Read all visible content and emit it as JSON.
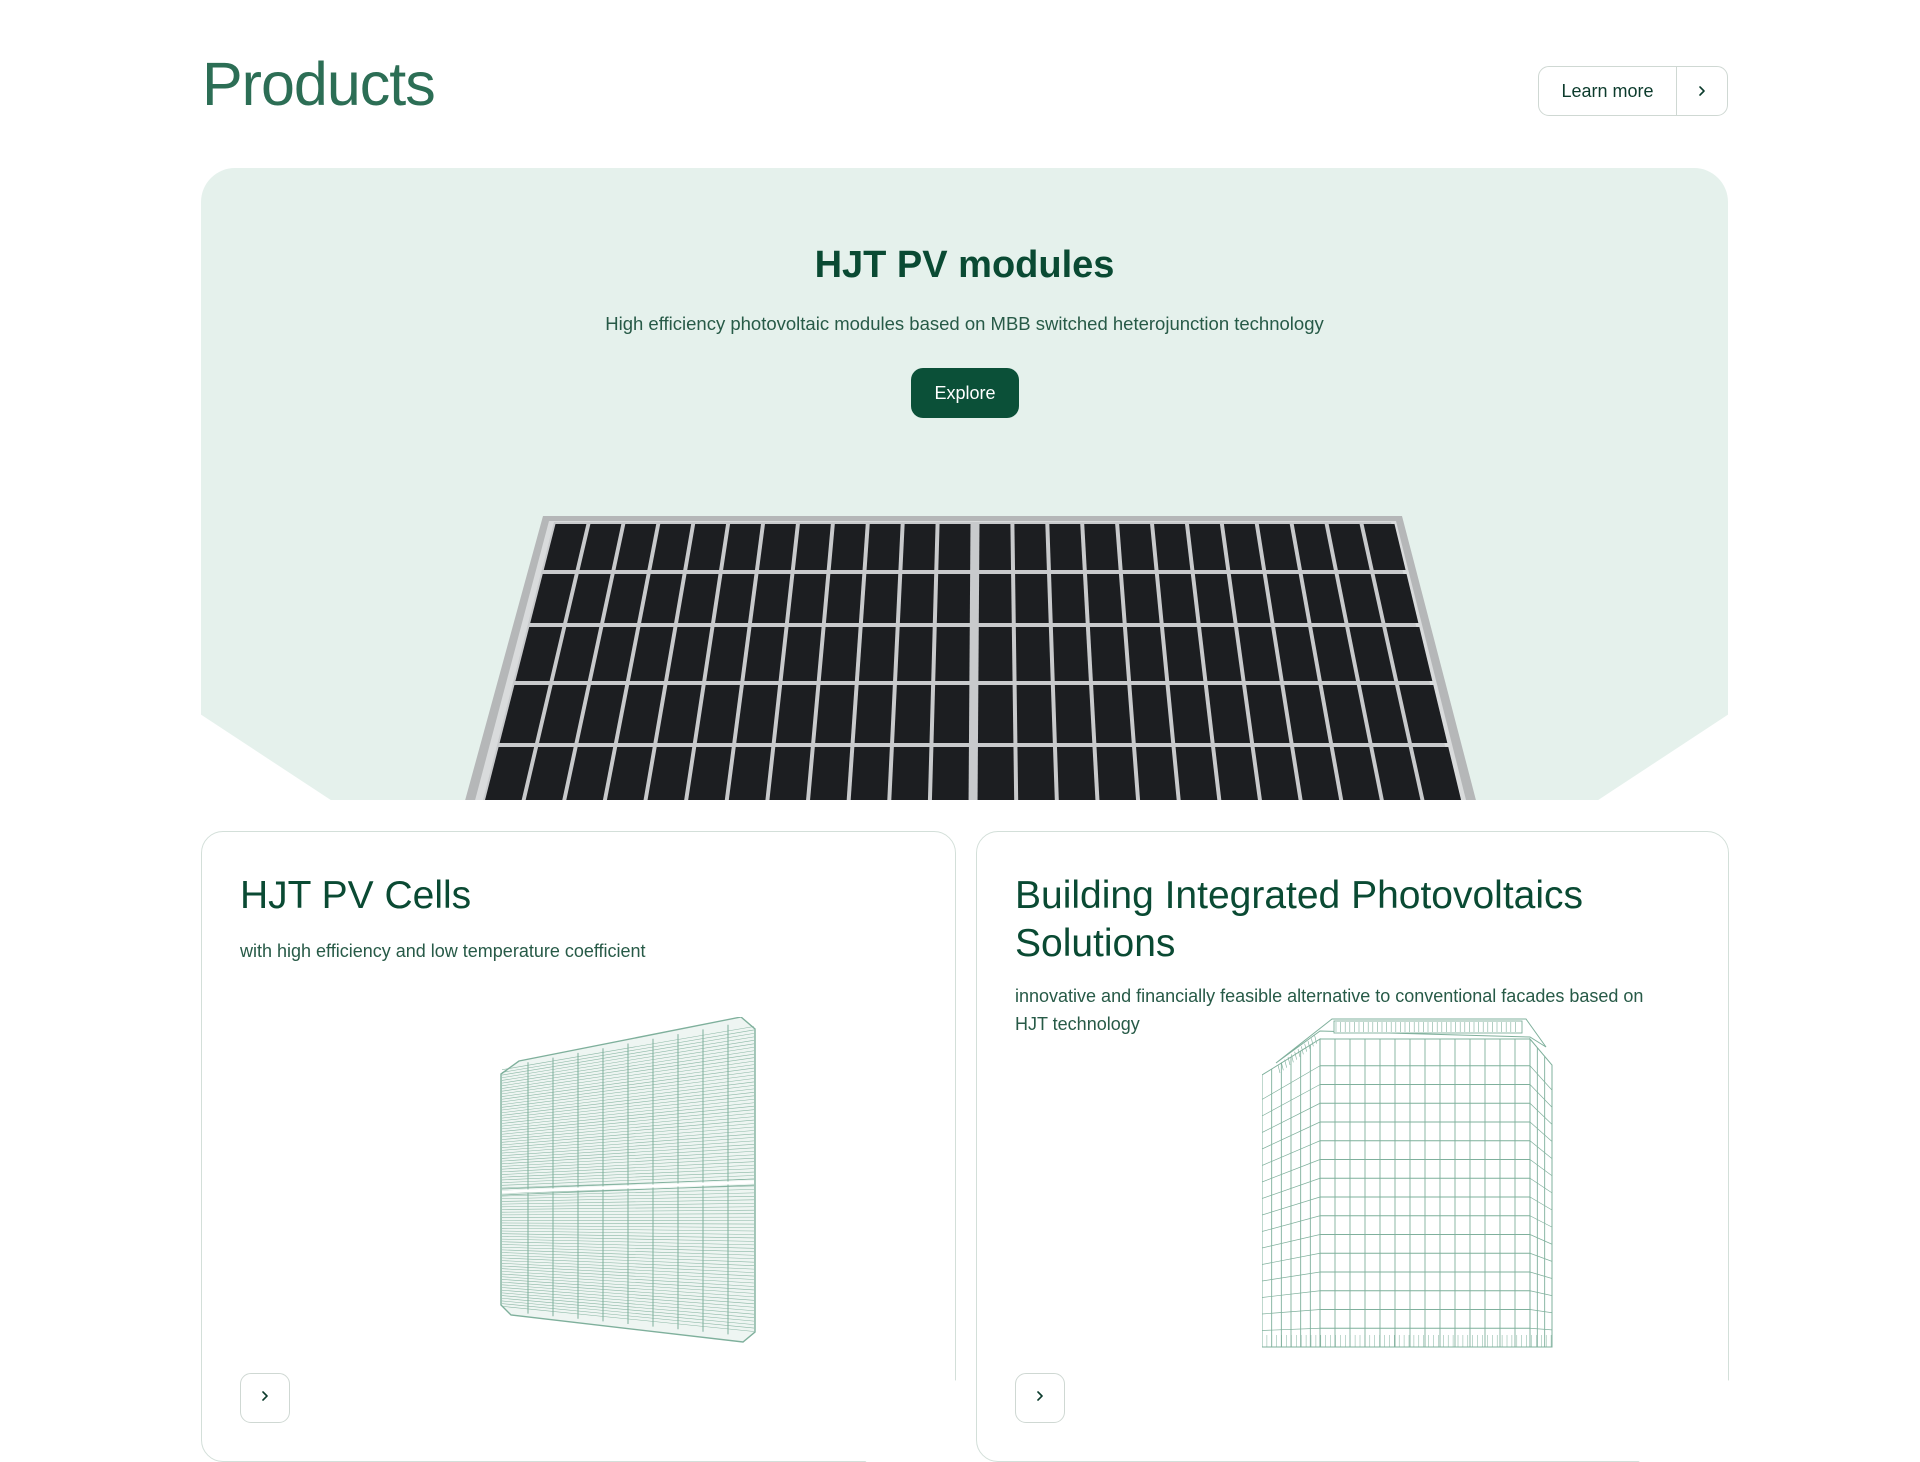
{
  "header": {
    "title": "Products",
    "learn_more_label": "Learn more"
  },
  "hero": {
    "title": "HJT PV modules",
    "subtitle": "High efficiency photovoltaic modules based on MBB switched heterojunction technology",
    "button_label": "Explore"
  },
  "cards": [
    {
      "title": "HJT PV Cells",
      "subtitle": "with high efficiency and low temperature coefficient"
    },
    {
      "title": "Building Integrated Photovoltaics Solutions",
      "subtitle": "innovative and financially feasible alternative to conventional facades based on HJT technology"
    }
  ],
  "colors": {
    "brand_green": "#0b5038",
    "title_green": "#2c6e55",
    "hero_bg": "#e5f1ec",
    "line_art": "#7fb09c"
  },
  "icons": [
    "chevron-right-icon",
    "solar-panel-illustration",
    "pv-cell-illustration",
    "building-illustration"
  ]
}
